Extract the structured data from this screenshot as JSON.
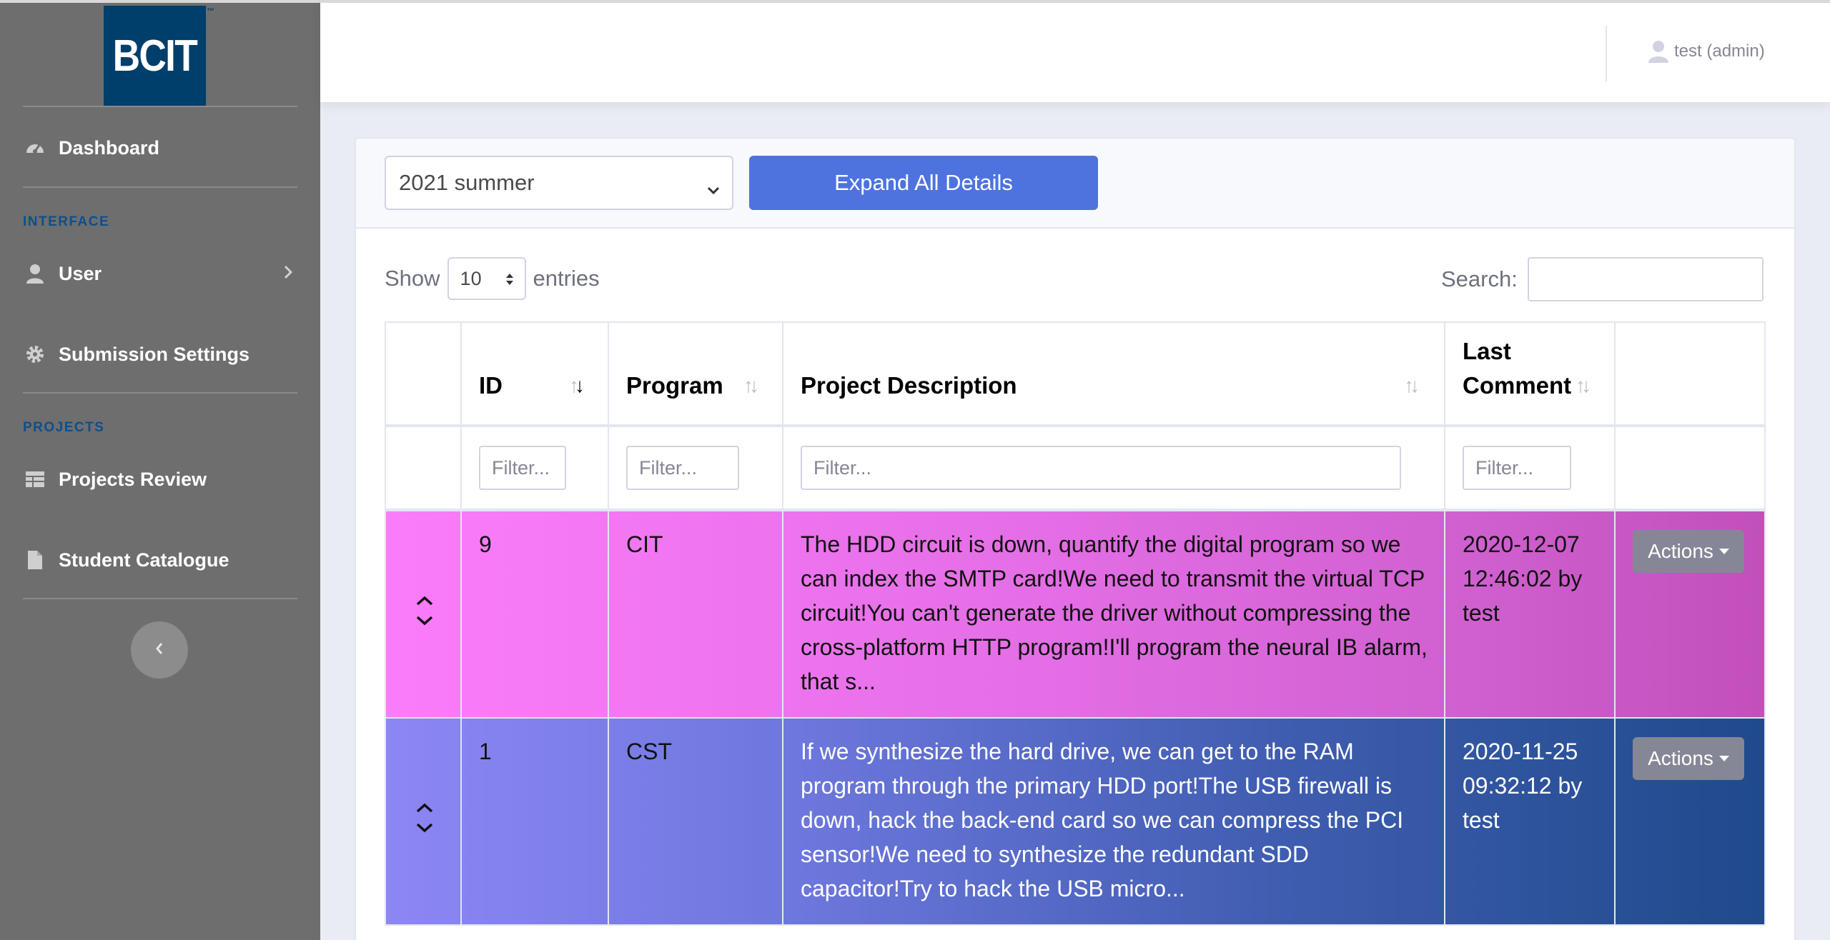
{
  "brand": {
    "logo_text": "BCIT",
    "trademark": "™"
  },
  "sidebar": {
    "dashboard": "Dashboard",
    "interface_heading": "INTERFACE",
    "user": "User",
    "submission_settings": "Submission Settings",
    "projects_heading": "PROJECTS",
    "projects_review": "Projects Review",
    "student_catalogue": "Student Catalogue"
  },
  "topbar": {
    "user_label": "test (admin)"
  },
  "controls": {
    "term_selected": "2021 summer",
    "expand_button": "Expand All Details",
    "show_label": "Show",
    "entries_value": "10",
    "entries_label": "entries",
    "search_label": "Search:"
  },
  "table": {
    "headers": {
      "id": "ID",
      "program": "Program",
      "description": "Project Description",
      "last_comment_line1": "Last",
      "last_comment_line2": "Comment"
    },
    "filter_placeholder": "Filter...",
    "rows": [
      {
        "id": "9",
        "program": "CIT",
        "description": "The HDD circuit is down, quantify the digital program so we can index the SMTP card!We need to transmit the virtual TCP circuit!You can't generate the driver without compressing the cross-platform HTTP program!I'll program the neural IB alarm, that s...",
        "last_comment_date": "2020-12-07",
        "last_comment_time": "12:46:02 by",
        "last_comment_user": "test",
        "actions": "Actions"
      },
      {
        "id": "1",
        "program": "CST",
        "description": "If we synthesize the hard drive, we can get to the RAM program through the primary HDD port!The USB firewall is down, hack the back-end card so we can compress the PCI sensor!We need to synthesize the redundant SDD capacitor!Try to hack the USB micro...",
        "last_comment_date": "2020-11-25",
        "last_comment_time": "09:32:12 by",
        "last_comment_user": "test",
        "actions": "Actions"
      }
    ]
  },
  "colors": {
    "sidebar_bg": "#6e6e6e",
    "brand_bg": "#003e6b",
    "primary": "#4e73df",
    "row_cit": "#f07ced",
    "row_cst": "#4a62b8"
  }
}
